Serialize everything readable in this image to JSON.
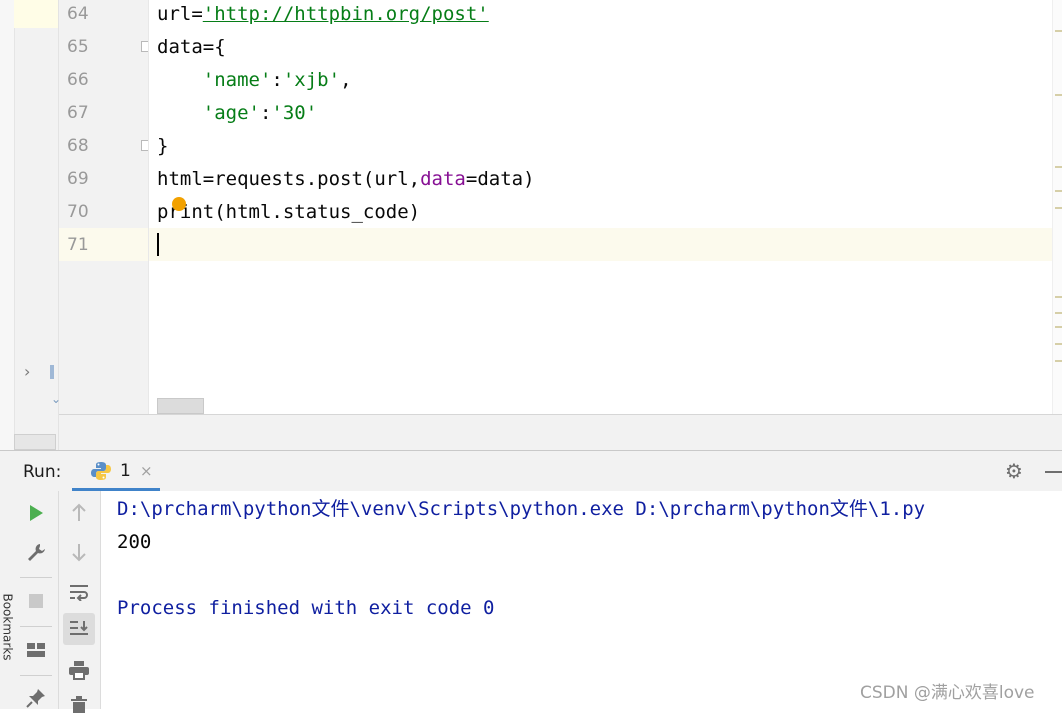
{
  "editor": {
    "line_numbers": [
      "64",
      "65",
      "66",
      "67",
      "68",
      "69",
      "70",
      "71"
    ],
    "lines": {
      "l64": {
        "pre": "url=",
        "str": "'http://httpbin.org/post'"
      },
      "l65": {
        "text": "data={"
      },
      "l66": {
        "indent": "    ",
        "key": "'name'",
        "sep": ":",
        "val": "'xjb'",
        "post": ","
      },
      "l67": {
        "indent": "    ",
        "key": "'age'",
        "sep": ":",
        "val": "'30'"
      },
      "l68": {
        "text": "}"
      },
      "l69": {
        "pre": "html=requests.post(url,",
        "kw": "data",
        "post": "=data)"
      },
      "l70": {
        "text": "print(html.status_code)"
      }
    },
    "current_line": "71",
    "intention_icon": "bulb-icon"
  },
  "run_panel": {
    "label": "Run:",
    "tab_name": "1",
    "tab_close": "×",
    "tab_icon": "python-icon",
    "settings_icon": "gear-icon",
    "hide_icon": "minimize-icon",
    "bookmarks_label": "Bookmarks",
    "toolbar_left": [
      "run-icon",
      "wrench-icon",
      "stop-icon",
      "layout-icon",
      "pin-icon"
    ],
    "toolbar_right": [
      "up-arrow-icon",
      "down-arrow-icon",
      "soft-wrap-icon",
      "scroll-to-end-icon",
      "print-icon",
      "trash-icon"
    ]
  },
  "console": {
    "command": "D:\\prcharm\\python文件\\venv\\Scripts\\python.exe D:\\prcharm\\python文件\\1.py",
    "output": "200",
    "finished": "Process finished with exit code 0"
  },
  "watermark": "CSDN @满心欢喜love",
  "colors": {
    "string": "#067d17",
    "keyword_arg": "#871094",
    "console_system": "#0f1fa0",
    "tab_underline": "#4083c9",
    "run_green": "#4caf50"
  }
}
